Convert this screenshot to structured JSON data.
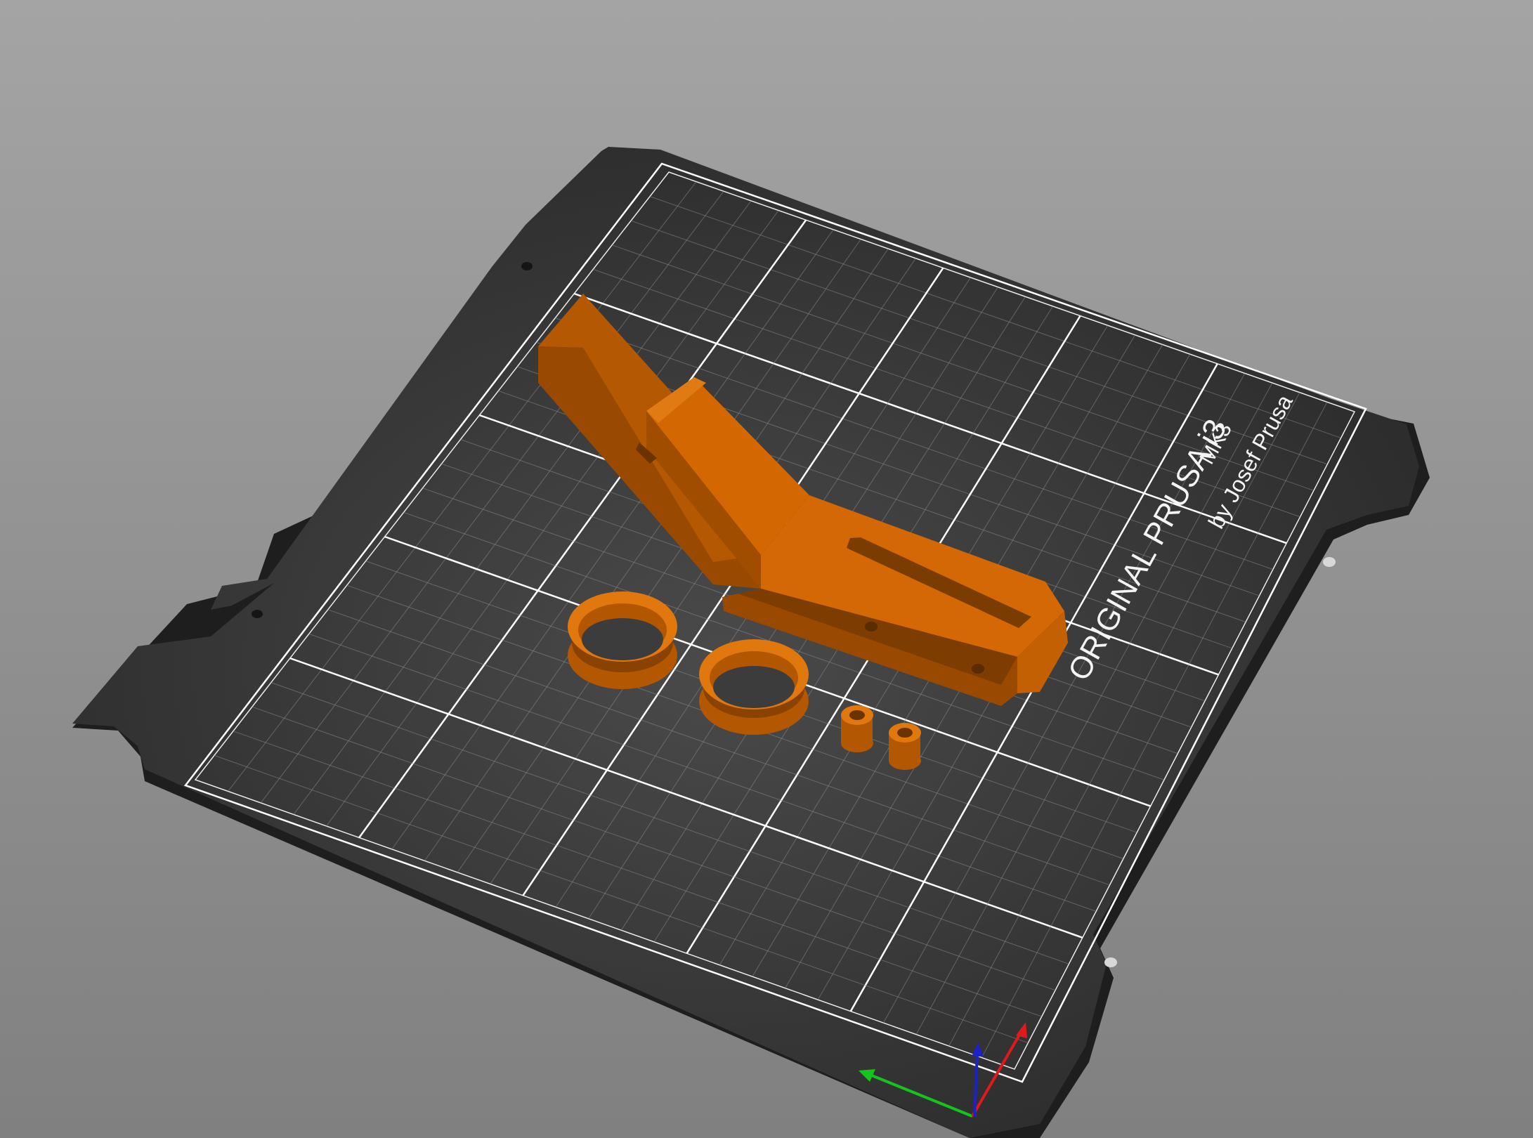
{
  "viewport": {
    "background_top": "#a4a4a4",
    "background_bottom": "#808080"
  },
  "bed": {
    "brand_line": "ORIGINAL PRUSA i3",
    "model": "MK3",
    "byline": "by Josef Prusa",
    "plate_color": "#333333",
    "plate_edge_color": "#1e1e1e",
    "grid_minor_color": "#8a8a8a",
    "grid_major_color": "#ffffff"
  },
  "objects": {
    "color_top": "#d76a05",
    "color_side": "#a45000",
    "color_dark": "#7a3c00",
    "items": [
      {
        "name": "angled-arm"
      },
      {
        "name": "pulley-ring-1"
      },
      {
        "name": "pulley-ring-2"
      },
      {
        "name": "spacer-1"
      },
      {
        "name": "spacer-2"
      }
    ]
  },
  "axes": {
    "x_color": "#e0191b",
    "y_color": "#15c41c",
    "z_color": "#1a22c8"
  }
}
